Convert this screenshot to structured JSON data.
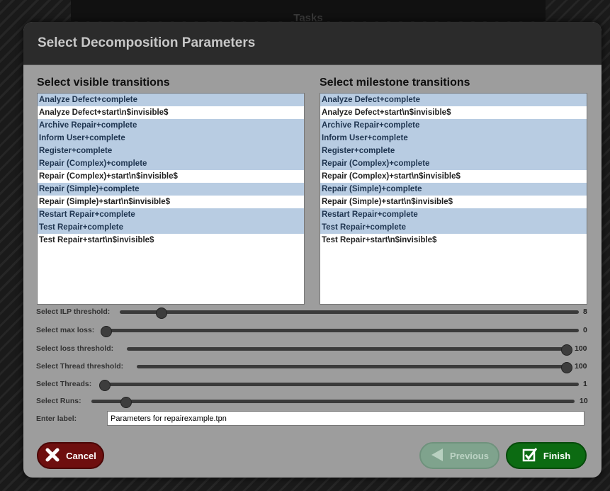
{
  "background": {
    "title": "Tasks"
  },
  "dialog": {
    "title": "Select Decomposition Parameters"
  },
  "visible": {
    "title": "Select visible transitions",
    "items": [
      {
        "label": "Analyze Defect+complete",
        "selected": true
      },
      {
        "label": "Analyze Defect+start\\n$invisible$",
        "selected": false
      },
      {
        "label": "Archive Repair+complete",
        "selected": true
      },
      {
        "label": "Inform User+complete",
        "selected": true
      },
      {
        "label": "Register+complete",
        "selected": true
      },
      {
        "label": "Repair (Complex)+complete",
        "selected": true
      },
      {
        "label": "Repair (Complex)+start\\n$invisible$",
        "selected": false
      },
      {
        "label": "Repair (Simple)+complete",
        "selected": true
      },
      {
        "label": "Repair (Simple)+start\\n$invisible$",
        "selected": false
      },
      {
        "label": "Restart Repair+complete",
        "selected": true
      },
      {
        "label": "Test Repair+complete",
        "selected": true
      },
      {
        "label": "Test Repair+start\\n$invisible$",
        "selected": false
      }
    ]
  },
  "milestone": {
    "title": "Select milestone transitions",
    "items": [
      {
        "label": "Analyze Defect+complete",
        "selected": true
      },
      {
        "label": "Analyze Defect+start\\n$invisible$",
        "selected": false
      },
      {
        "label": "Archive Repair+complete",
        "selected": true
      },
      {
        "label": "Inform User+complete",
        "selected": true
      },
      {
        "label": "Register+complete",
        "selected": true
      },
      {
        "label": "Repair (Complex)+complete",
        "selected": true
      },
      {
        "label": "Repair (Complex)+start\\n$invisible$",
        "selected": false
      },
      {
        "label": "Repair (Simple)+complete",
        "selected": true
      },
      {
        "label": "Repair (Simple)+start\\n$invisible$",
        "selected": false
      },
      {
        "label": "Restart Repair+complete",
        "selected": true
      },
      {
        "label": "Test Repair+complete",
        "selected": true
      },
      {
        "label": "Test Repair+start\\n$invisible$",
        "selected": false
      }
    ]
  },
  "sliders": {
    "ilp": {
      "label": "Select ILP threshold:",
      "value": "8",
      "fraction": 0.09
    },
    "max_loss": {
      "label": "Select max loss:",
      "value": "0",
      "fraction": 0.0
    },
    "loss_threshold": {
      "label": "Select loss threshold:",
      "value": "100",
      "fraction": 1.0
    },
    "thread_threshold": {
      "label": "Select Thread threshold:",
      "value": "100",
      "fraction": 1.0
    },
    "threads": {
      "label": "Select Threads:",
      "value": "1",
      "fraction": 0.0
    },
    "runs": {
      "label": "Select Runs:",
      "value": "10",
      "fraction": 0.07
    }
  },
  "label_field": {
    "label": "Enter label:",
    "value": "Parameters for repairexample.tpn"
  },
  "buttons": {
    "cancel": "Cancel",
    "previous": "Previous",
    "finish": "Finish"
  }
}
